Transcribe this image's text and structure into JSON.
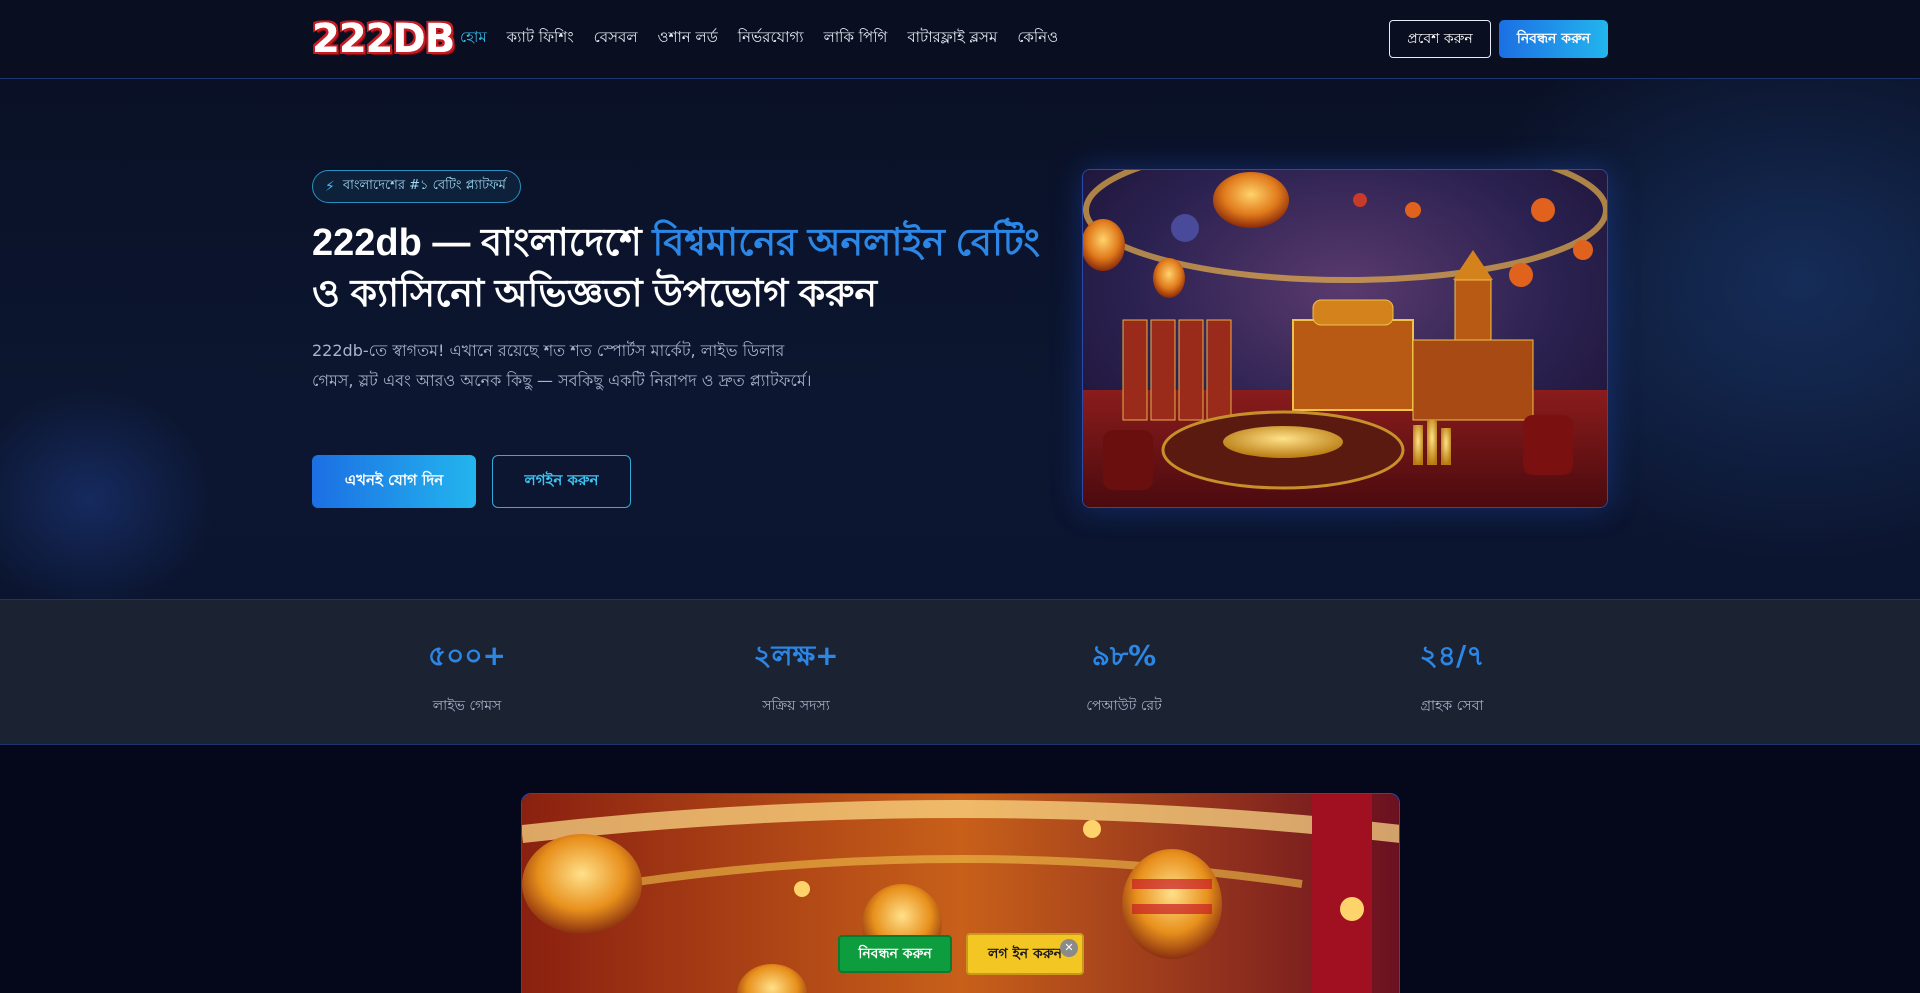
{
  "brand": {
    "logo_text": "222DB"
  },
  "nav": {
    "items": [
      {
        "label": "হোম",
        "active": true
      },
      {
        "label": "ক্যাট ফিশিং",
        "active": false
      },
      {
        "label": "বেসবল",
        "active": false
      },
      {
        "label": "ওশান লর্ড",
        "active": false
      },
      {
        "label": "নির্ভরযোগ্য",
        "active": false
      },
      {
        "label": "লাকি পিগি",
        "active": false
      },
      {
        "label": "বাটারফ্লাই ব্লসম",
        "active": false
      },
      {
        "label": "কেনিও",
        "active": false
      }
    ],
    "login_label": "প্রবেশ করুন",
    "register_label": "নিবন্ধন করুন"
  },
  "hero": {
    "badge_icon": "bolt-icon",
    "badge_text": "বাংলাদেশের #১ বেটিং প্ল্যাটফর্ম",
    "title_part1": "222db — বাংলাদেশে ",
    "title_highlight": "বিশ্বমানের অনলাইন বেটিং",
    "title_part2": "ও ক্যাসিনো অভিজ্ঞতা উপভোগ করুন",
    "description": "222db-তে স্বাগতম! এখানে রয়েছে শত শত স্পোর্টস মার্কেট, লাইভ ডিলার গেমস, স্লট এবং আরও অনেক কিছু — সবকিছু একটি নিরাপদ ও দ্রুত প্ল্যাটফর্মে।",
    "join_label": "এখনই যোগ দিন",
    "login_label": "লগইন করুন"
  },
  "stats": [
    {
      "value": "৫০০+",
      "label": "লাইভ গেমস"
    },
    {
      "value": "২লক্ষ+",
      "label": "সক্রিয় সদস্য"
    },
    {
      "value": "৯৮%",
      "label": "পেআউট রেট"
    },
    {
      "value": "২৪/৭",
      "label": "গ্রাহক সেবা"
    }
  ],
  "floating": {
    "register_label": "নিবন্ধন করুন",
    "login_label": "লগ ইন করুন",
    "close_icon": "close-icon",
    "close_glyph": "✕"
  },
  "colors": {
    "accent_blue": "#2b86e6",
    "accent_cyan": "#36c1f0",
    "float_green": "#0d9c3e",
    "float_yellow": "#f3c623"
  }
}
